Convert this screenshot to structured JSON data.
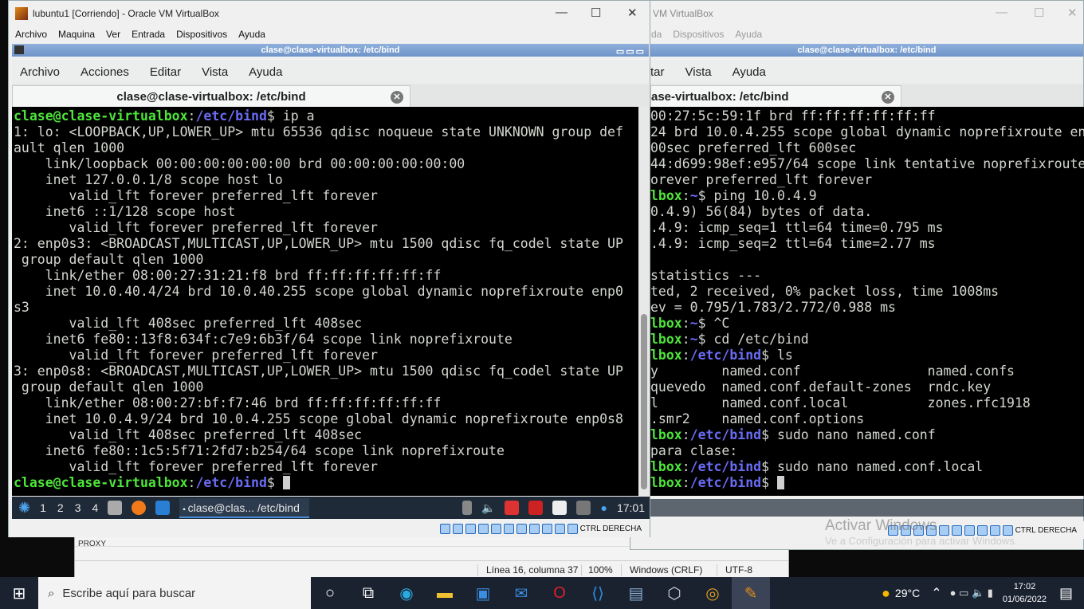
{
  "left_vm": {
    "title": "lubuntu1 [Corriendo] - Oracle VM VirtualBox",
    "menu": [
      "Archivo",
      "Maquina",
      "Ver",
      "Entrada",
      "Dispositivos",
      "Ayuda"
    ],
    "terminal_title": "clase@clase-virtualbox: /etc/bind",
    "terminal_menu": [
      "Archivo",
      "Acciones",
      "Editar",
      "Vista",
      "Ayuda"
    ],
    "tab_label": "clase@clase-virtualbox: /etc/bind",
    "lines": [
      {
        "u": "clase@clase-virtualbox",
        "p": "/etc/bind",
        "c": " ip a"
      },
      {
        "t": "1: lo: <LOOPBACK,UP,LOWER_UP> mtu 65536 qdisc noqueue state UNKNOWN group def"
      },
      {
        "t": "ault qlen 1000"
      },
      {
        "t": "    link/loopback 00:00:00:00:00:00 brd 00:00:00:00:00:00"
      },
      {
        "t": "    inet 127.0.0.1/8 scope host lo"
      },
      {
        "t": "       valid_lft forever preferred_lft forever"
      },
      {
        "t": "    inet6 ::1/128 scope host"
      },
      {
        "t": "       valid_lft forever preferred_lft forever"
      },
      {
        "t": "2: enp0s3: <BROADCAST,MULTICAST,UP,LOWER_UP> mtu 1500 qdisc fq_codel state UP"
      },
      {
        "t": " group default qlen 1000"
      },
      {
        "t": "    link/ether 08:00:27:31:21:f8 brd ff:ff:ff:ff:ff:ff"
      },
      {
        "t": "    inet 10.0.40.4/24 brd 10.0.40.255 scope global dynamic noprefixroute enp0"
      },
      {
        "t": "s3"
      },
      {
        "t": "       valid_lft 408sec preferred_lft 408sec"
      },
      {
        "t": "    inet6 fe80::13f8:634f:c7e9:6b3f/64 scope link noprefixroute"
      },
      {
        "t": "       valid_lft forever preferred_lft forever"
      },
      {
        "t": "3: enp0s8: <BROADCAST,MULTICAST,UP,LOWER_UP> mtu 1500 qdisc fq_codel state UP"
      },
      {
        "t": " group default qlen 1000"
      },
      {
        "t": "    link/ether 08:00:27:bf:f7:46 brd ff:ff:ff:ff:ff:ff"
      },
      {
        "t": "    inet 10.0.4.9/24 brd 10.0.4.255 scope global dynamic noprefixroute enp0s8"
      },
      {
        "t": "       valid_lft 408sec preferred_lft 408sec"
      },
      {
        "t": "    inet6 fe80::1c5:5f71:2fd7:b254/64 scope link noprefixroute"
      },
      {
        "t": "       valid_lft forever preferred_lft forever"
      },
      {
        "u": "clase@clase-virtualbox",
        "p": "/etc/bind",
        "c": " ",
        "cursor": true
      }
    ],
    "taskbar": {
      "workspaces": [
        "1",
        "2",
        "3",
        "4"
      ],
      "task": "clase@clas... /etc/bind",
      "clock": "17:01"
    },
    "status_host_key": "CTRL DERECHA"
  },
  "right_vm": {
    "title": "VM VirtualBox",
    "menu": [
      "da",
      "Dispositivos",
      "Ayuda"
    ],
    "terminal_title": "clase@clase-virtualbox: /etc/bind",
    "terminal_menu": [
      "tar",
      "Vista",
      "Ayuda"
    ],
    "tab_label": "ase-virtualbox: /etc/bind",
    "lines": [
      {
        "t": "00:27:5c:59:1f brd ff:ff:ff:ff:ff:ff"
      },
      {
        "t": "24 brd 10.0.4.255 scope global dynamic noprefixroute en"
      },
      {
        "t": "00sec preferred_lft 600sec"
      },
      {
        "t": "44:d699:98ef:e957/64 scope link tentative noprefixroute"
      },
      {
        "t": "orever preferred_lft forever"
      },
      {
        "u": "lbox",
        "p": "~",
        "c": " ping 10.0.4.9"
      },
      {
        "t": "0.4.9) 56(84) bytes of data."
      },
      {
        "t": ".4.9: icmp_seq=1 ttl=64 time=0.795 ms"
      },
      {
        "t": ".4.9: icmp_seq=2 ttl=64 time=2.77 ms"
      },
      {
        "t": ""
      },
      {
        "t": "statistics ---"
      },
      {
        "t": "ted, 2 received, 0% packet loss, time 1008ms"
      },
      {
        "t": "ev = 0.795/1.783/2.772/0.988 ms"
      },
      {
        "u": "lbox",
        "p": "~",
        "c": " ^C"
      },
      {
        "u": "lbox",
        "p": "~",
        "c": " cd /etc/bind"
      },
      {
        "u": "lbox",
        "p": "/etc/bind",
        "c": " ls"
      },
      {
        "t": "y        named.conf                named.confs"
      },
      {
        "t": "quevedo  named.conf.default-zones  rndc.key"
      },
      {
        "t": "l        named.conf.local          zones.rfc1918"
      },
      {
        "t": ".smr2    named.conf.options"
      },
      {
        "u": "lbox",
        "p": "/etc/bind",
        "c": " sudo nano named.conf"
      },
      {
        "t": "para clase:"
      },
      {
        "u": "lbox",
        "p": "/etc/bind",
        "c": " sudo nano named.conf.local"
      },
      {
        "u": "lbox",
        "p": "/etc/bind",
        "c": " ",
        "cursor": true
      }
    ],
    "status_host_key": "CTRL DERECHA",
    "activation_title": "Activar Windows",
    "activation_sub": "Ve a Configuración para activar Windows."
  },
  "notepad": {
    "partial_text": "PROXY",
    "status": [
      "Línea 16, columna 37",
      "100%",
      "Windows (CRLF)",
      "UTF-8"
    ]
  },
  "win_taskbar": {
    "search_placeholder": "Escribe aquí para buscar",
    "weather": "29°C",
    "time": "17:02",
    "date": "01/06/2022"
  }
}
